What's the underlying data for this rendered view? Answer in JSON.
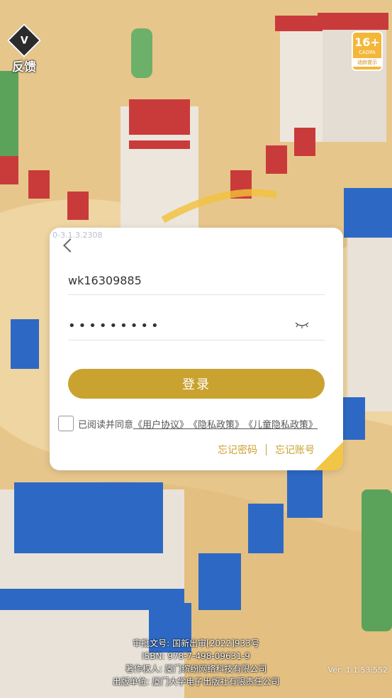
{
  "feedback": {
    "label": "反馈"
  },
  "age_rating": {
    "age": "16+",
    "org": "CADPA",
    "tip": "适龄提示"
  },
  "dialog": {
    "build_tag": "0-3.1.3.2308",
    "username_value": "wk16309885",
    "password_value": "•••••••••",
    "login_label": "登录",
    "agree_prefix": "已阅读并同意",
    "user_agreement": "《用户协议》",
    "privacy_policy": "《隐私政策》",
    "children_privacy": "《儿童隐私政策》",
    "forgot_password": "忘记密码",
    "forgot_account": "忘记账号"
  },
  "footer": {
    "line1": "审批文号: 国新出审[2022]933号",
    "line2": "ISBN: 978-7-498-09631-9",
    "line3": "著作权人: 厦门缤纷网络科技有限公司",
    "line4": "出版单位: 厦门大学电子出版社有限责任公司",
    "version": "Ver: 1.1.53.552"
  },
  "colors": {
    "accent": "#c9a22f",
    "badge": "#f4b73a"
  },
  "icons": [
    "feedback-logo-icon",
    "back-chevron-icon",
    "eye-closed-icon",
    "support-icon"
  ]
}
